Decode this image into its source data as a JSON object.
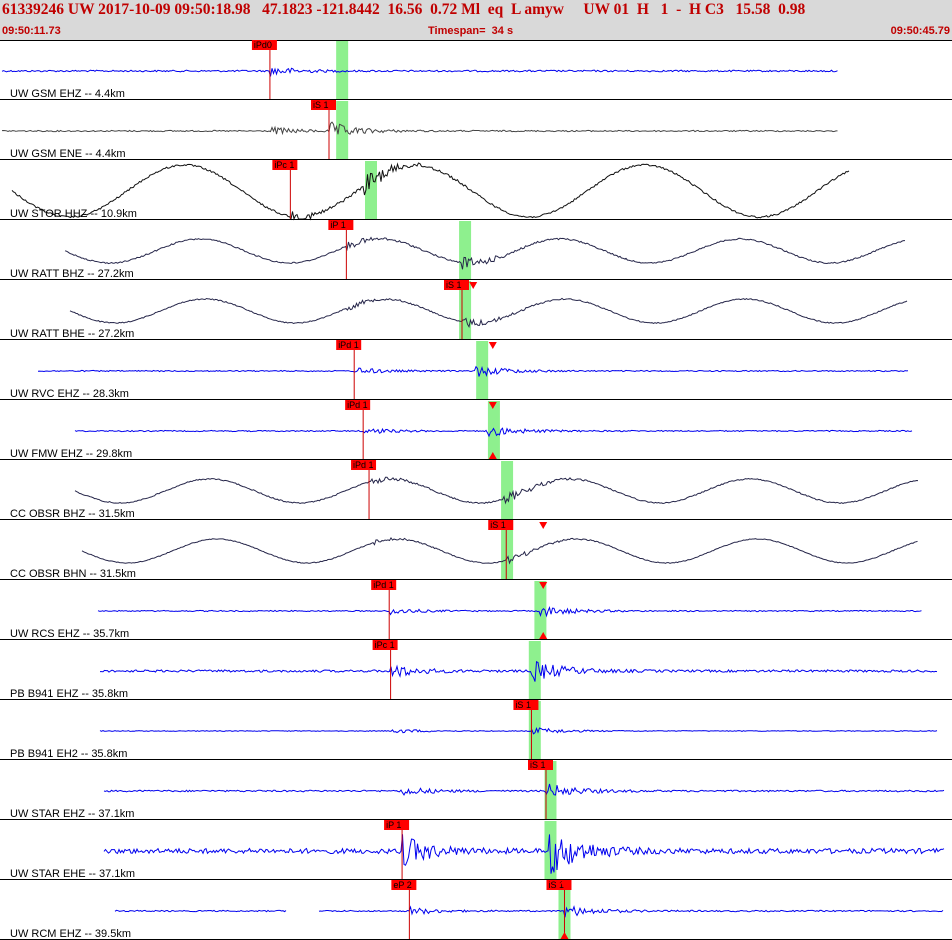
{
  "header": {
    "event_line": "61339246 UW 2017-10-09 09:50:18.98   47.1823 -121.8442  16.56  0.72 Ml  eq  L amyw     UW 01  H   1  -  H C3   15.58  0.98",
    "start_time": "09:50:11.73",
    "timespan": "Timespan=  34 s",
    "end_time": "09:50:45.79"
  },
  "colors": {
    "blue_trace": "#0000ee",
    "gray_trace": "#444444",
    "black_trace": "#111111",
    "dark_trace": "#26264a",
    "pick_flag": "#ff0000",
    "pick_line": "#cc0000",
    "window_band": "#8ef08e"
  },
  "chart_data": {
    "type": "seismogram",
    "x_unit": "s",
    "xlim": [
      0,
      34
    ],
    "traces": [
      {
        "label": "UW GSM EHZ -- 4.4km",
        "color": "#0000ee",
        "amp": 0.25,
        "p": 9.64,
        "s": 0,
        "band": 12.22,
        "picks": [
          {
            "label": "iPd0",
            "t": 9.64
          }
        ],
        "markers": []
      },
      {
        "label": "UW GSM ENE -- 4.4km",
        "color": "#444444",
        "amp": 0.2,
        "p": 9.66,
        "s": 11.75,
        "band": 12.22,
        "picks": [
          {
            "label": "iS 1",
            "t": 11.75
          }
        ],
        "markers": []
      },
      {
        "label": "UW STOR HHZ -- 10.9km",
        "color": "#111111",
        "amp": 0.35,
        "p": 10.37,
        "s": 13.0,
        "band": 13.25,
        "picks": [
          {
            "label": "iPc 1",
            "t": 10.37
          }
        ],
        "markers": []
      },
      {
        "label": "UW RATT BHZ -- 27.2km",
        "color": "#26264a",
        "amp": 0.25,
        "p": 12.37,
        "s": 16.5,
        "band": 16.61,
        "picks": [
          {
            "label": "iP 1",
            "t": 12.37
          }
        ],
        "markers": []
      },
      {
        "label": "UW RATT BHE -- 27.2km",
        "color": "#26264a",
        "amp": 0.2,
        "p": 12.4,
        "s": 16.5,
        "band": 16.61,
        "picks": [
          {
            "label": "iS 1",
            "t": 16.5
          }
        ],
        "markers": [
          {
            "t": 16.9,
            "pos": "top"
          }
        ]
      },
      {
        "label": "UW RVC EHZ -- 28.3km",
        "color": "#0000ee",
        "amp": 0.18,
        "p": 12.65,
        "s": 17.0,
        "band": 17.22,
        "picks": [
          {
            "label": "iPd 1",
            "t": 12.65
          }
        ],
        "markers": [
          {
            "t": 17.6,
            "pos": "top"
          }
        ]
      },
      {
        "label": "UW FMW EHZ -- 29.8km",
        "color": "#0000ee",
        "amp": 0.18,
        "p": 12.97,
        "s": 17.4,
        "band": 17.64,
        "picks": [
          {
            "label": "iPd 1",
            "t": 12.97
          }
        ],
        "markers": [
          {
            "t": 17.6,
            "pos": "top"
          },
          {
            "t": 17.6,
            "pos": "bottom"
          }
        ]
      },
      {
        "label": "CC OBSR BHZ -- 31.5km",
        "color": "#26264a",
        "amp": 0.22,
        "p": 13.18,
        "s": 18.0,
        "band": 18.11,
        "picks": [
          {
            "label": "iPd 1",
            "t": 13.18
          }
        ],
        "markers": []
      },
      {
        "label": "CC OBSR BHN -- 31.5km",
        "color": "#26264a",
        "amp": 0.15,
        "p": 13.3,
        "s": 18.08,
        "band": 18.11,
        "picks": [
          {
            "label": "iS 1",
            "t": 18.08
          }
        ],
        "markers": [
          {
            "t": 19.4,
            "pos": "top"
          }
        ]
      },
      {
        "label": "UW RCS EHZ -- 35.7km",
        "color": "#0000ee",
        "amp": 0.18,
        "p": 13.9,
        "s": 19.3,
        "band": 19.3,
        "picks": [
          {
            "label": "iPd 1",
            "t": 13.9
          }
        ],
        "markers": [
          {
            "t": 19.4,
            "pos": "top"
          },
          {
            "t": 19.4,
            "pos": "bottom"
          }
        ]
      },
      {
        "label": "PB B941 EHZ -- 35.8km",
        "color": "#0000ee",
        "amp": 0.35,
        "p": 13.95,
        "s": 19.0,
        "band": 19.1,
        "picks": [
          {
            "label": "iPc 1",
            "t": 13.95
          }
        ],
        "markers": []
      },
      {
        "label": "PB B941 EH2 -- 35.8km",
        "color": "#0000ee",
        "amp": 0.12,
        "p": 14.0,
        "s": 18.98,
        "band": 19.1,
        "picks": [
          {
            "label": "iS 1",
            "t": 18.98
          }
        ],
        "markers": []
      },
      {
        "label": "UW STAR EHZ -- 37.1km",
        "color": "#0000ee",
        "amp": 0.25,
        "p": 14.3,
        "s": 19.5,
        "band": 19.66,
        "picks": [
          {
            "label": "iS 1",
            "t": 19.5
          }
        ],
        "markers": []
      },
      {
        "label": "UW STAR EHE -- 37.1km",
        "color": "#0000ee",
        "amp": 0.55,
        "p": 14.36,
        "s": 19.6,
        "band": 19.66,
        "picks": [
          {
            "label": "iP 1",
            "t": 14.36
          }
        ],
        "markers": []
      },
      {
        "label": "UW RCM EHZ -- 39.5km",
        "color": "#0000ee",
        "amp": 0.2,
        "p": 14.62,
        "s": 20.16,
        "band": 20.16,
        "picks": [
          {
            "label": "eP 2",
            "t": 14.62
          },
          {
            "label": "iS 1",
            "t": 20.16
          }
        ],
        "markers": [
          {
            "t": 20.16,
            "pos": "top"
          },
          {
            "t": 20.16,
            "pos": "bottom"
          }
        ]
      }
    ]
  }
}
